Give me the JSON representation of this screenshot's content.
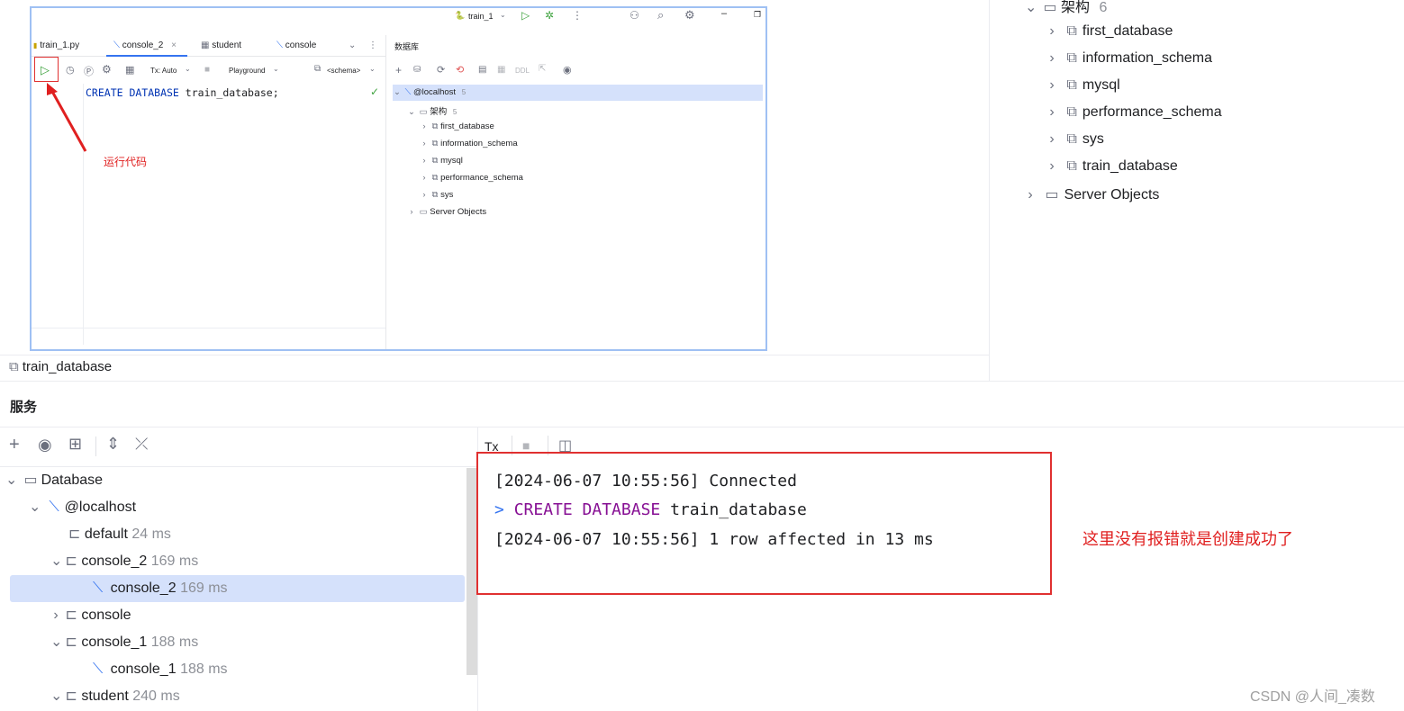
{
  "embed": {
    "run_config": "train_1",
    "tabs": [
      "train_1.py",
      "console_2",
      "student",
      "console"
    ],
    "toolbar": {
      "tx_label": "Tx: Auto",
      "playground_label": "Playground",
      "schema_label": "<schema>"
    },
    "code": {
      "keyword": "CREATE DATABASE",
      "identifier": "train_database",
      "semicolon": ";"
    },
    "db_panel_title": "数据库",
    "db_toolbar_ddl": "DDL",
    "tree": {
      "host": "@localhost",
      "host_count": "5",
      "schema_folder": "架构",
      "schema_count": "5",
      "databases": [
        "first_database",
        "information_schema",
        "mysql",
        "performance_schema",
        "sys"
      ],
      "server_objects": "Server Objects"
    },
    "annotation": "运行代码"
  },
  "breadcrumb": "train_database",
  "right_tree": {
    "folder": "架构",
    "folder_count": "6",
    "databases": [
      "first_database",
      "information_schema",
      "mysql",
      "performance_schema",
      "sys",
      "train_database"
    ],
    "server_objects": "Server Objects"
  },
  "services": {
    "title": "服务",
    "tree": [
      {
        "label": "Database",
        "time": "",
        "level": 0,
        "expanded": true,
        "icon": "folder-icon"
      },
      {
        "label": "@localhost",
        "time": "",
        "level": 1,
        "expanded": true,
        "icon": "mysql-icon"
      },
      {
        "label": "default",
        "time": "24 ms",
        "level": 2,
        "expanded": null,
        "icon": "session-icon"
      },
      {
        "label": "console_2",
        "time": "169 ms",
        "level": 2,
        "expanded": true,
        "icon": "session-icon"
      },
      {
        "label": "console_2",
        "time": "169 ms",
        "level": 3,
        "expanded": null,
        "icon": "console-icon",
        "selected": true
      },
      {
        "label": "console",
        "time": "",
        "level": 2,
        "expanded": false,
        "icon": "session-icon"
      },
      {
        "label": "console_1",
        "time": "188 ms",
        "level": 2,
        "expanded": true,
        "icon": "session-icon"
      },
      {
        "label": "console_1",
        "time": "188 ms",
        "level": 3,
        "expanded": null,
        "icon": "console-icon"
      },
      {
        "label": "student",
        "time": "240 ms",
        "level": 2,
        "expanded": true,
        "icon": "session-icon"
      }
    ]
  },
  "output": {
    "toolbar_tx": "Tx",
    "lines": {
      "connected": "[2024-06-07 10:55:56] Connected",
      "prompt": ">",
      "cmd_keyword": "CREATE DATABASE",
      "cmd_identifier": "train_database",
      "result": "[2024-06-07 10:55:56] 1 row affected in 13 ms"
    },
    "annotation": "这里没有报错就是创建成功了"
  },
  "watermark": "CSDN @人间_凑数",
  "colors": {
    "accent": "#3574f0",
    "selection": "#d5e1fb",
    "annotation_red": "#e02020",
    "keyword_purple": "#871094",
    "run_green": "#3fa33f"
  }
}
